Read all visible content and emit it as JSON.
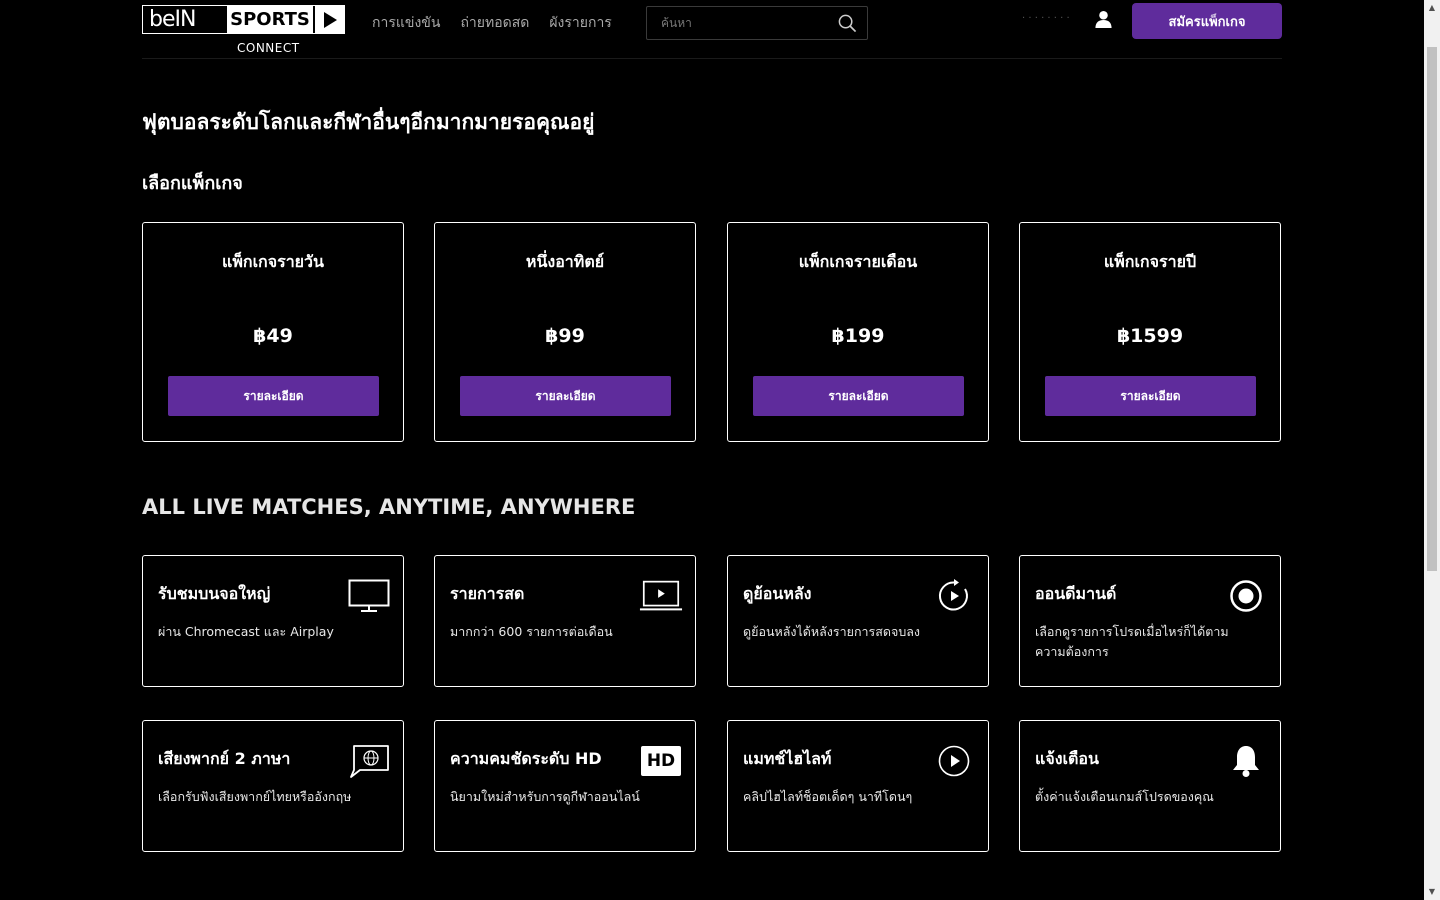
{
  "header": {
    "logo": {
      "bein": "beIN",
      "sports": "SPORTS",
      "connect": "CONNECT"
    },
    "nav": [
      "การแข่งขัน",
      "ถ่ายทอดสด",
      "ผังรายการ"
    ],
    "search_placeholder": "ค้นหา",
    "user_text": "· · · · · · · ·",
    "signup_label": "สมัครแพ็กเกจ"
  },
  "headline": "ฟุตบอลระดับโลกและกีฬาอื่นๆอีกมากมายรอคุณอยู่",
  "packages_title": "เลือกแพ็กเกจ",
  "packages": [
    {
      "name": "แพ็กเกจรายวัน",
      "price": "฿49",
      "button": "รายละเอียด"
    },
    {
      "name": "หนึ่งอาทิตย์",
      "price": "฿99",
      "button": "รายละเอียด"
    },
    {
      "name": "แพ็กเกจรายเดือน",
      "price": "฿199",
      "button": "รายละเอียด"
    },
    {
      "name": "แพ็กเกจรายปี",
      "price": "฿1599",
      "button": "รายละเอียด"
    }
  ],
  "features_title": "ALL LIVE MATCHES, ANYTIME, ANYWHERE",
  "features": [
    {
      "title": "รับชมบนจอใหญ่",
      "desc": "ผ่าน Chromecast และ Airplay",
      "icon": "tv-icon"
    },
    {
      "title": "รายการสด",
      "desc": "มากกว่า 600 รายการต่อเดือน",
      "icon": "laptop-play-icon"
    },
    {
      "title": "ดูย้อนหลัง",
      "desc": "ดูย้อนหลังได้หลังรายการสดจบลง",
      "icon": "replay-icon"
    },
    {
      "title": "ออนดีมานด์",
      "desc": "เลือกดูรายการโปรดเมื่อไหร่ก็ได้ตามความต้องการ",
      "icon": "on-demand-icon"
    },
    {
      "title": "เสียงพากย์ 2 ภาษา",
      "desc": "เลือกรับฟังเสียงพากย์ไทยหรืออังกฤษ",
      "icon": "language-icon"
    },
    {
      "title": "ความคมชัดระดับ HD",
      "desc": "นิยามใหม่สำหรับการดูกีฬาออนไลน์",
      "icon": "hd-icon",
      "badge": "HD"
    },
    {
      "title": "แมทช์ไฮไลท์",
      "desc": "คลิปไฮไลท์ช็อตเด็ดๆ นาทีโดนๆ",
      "icon": "play-circle-icon"
    },
    {
      "title": "แจ้งเตือน",
      "desc": "ตั้งค่าแจ้งเตือนเกมส์โปรดของคุณ",
      "icon": "bell-icon"
    }
  ],
  "colors": {
    "accent": "#5f2c9c",
    "background": "#000000",
    "border": "#ffffff"
  }
}
